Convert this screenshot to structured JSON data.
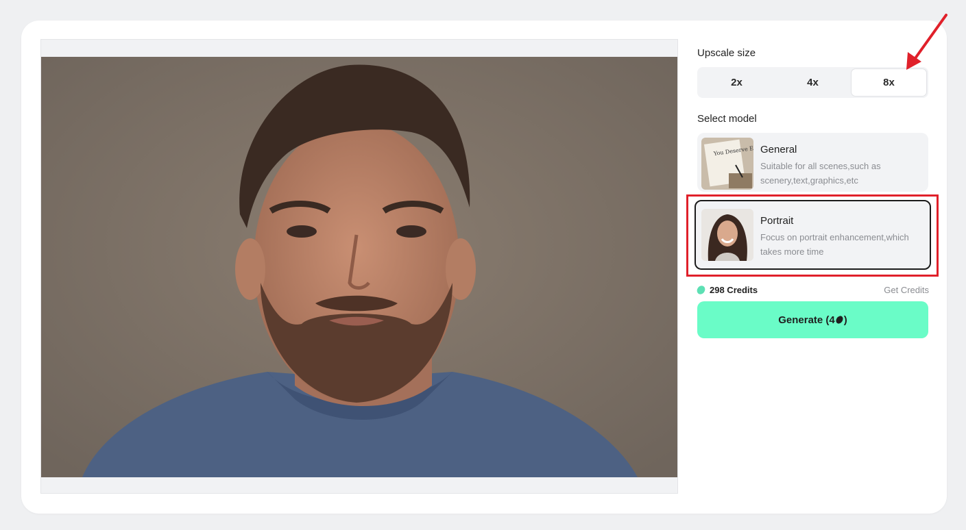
{
  "upscale": {
    "label": "Upscale size",
    "options": [
      "2x",
      "4x",
      "8x"
    ],
    "selected": "8x"
  },
  "model": {
    "label": "Select model",
    "items": [
      {
        "title": "General",
        "desc": "Suitable for all scenes,such as scenery,text,graphics,etc",
        "thumb_text": "You Deserve Each Other"
      },
      {
        "title": "Portrait",
        "desc": "Focus on portrait enhancement,which takes more time"
      }
    ],
    "selected": "Portrait"
  },
  "credits": {
    "amount_text": "298 Credits",
    "get_label": "Get Credits"
  },
  "generate": {
    "label_prefix": "Generate (4",
    "label_suffix": ")"
  },
  "colors": {
    "accent": "#6afcc7",
    "annotation": "#e0202a",
    "bean": "#5de0b4"
  },
  "icons": [
    "credit-bean-icon",
    "annotation-arrow-icon"
  ]
}
